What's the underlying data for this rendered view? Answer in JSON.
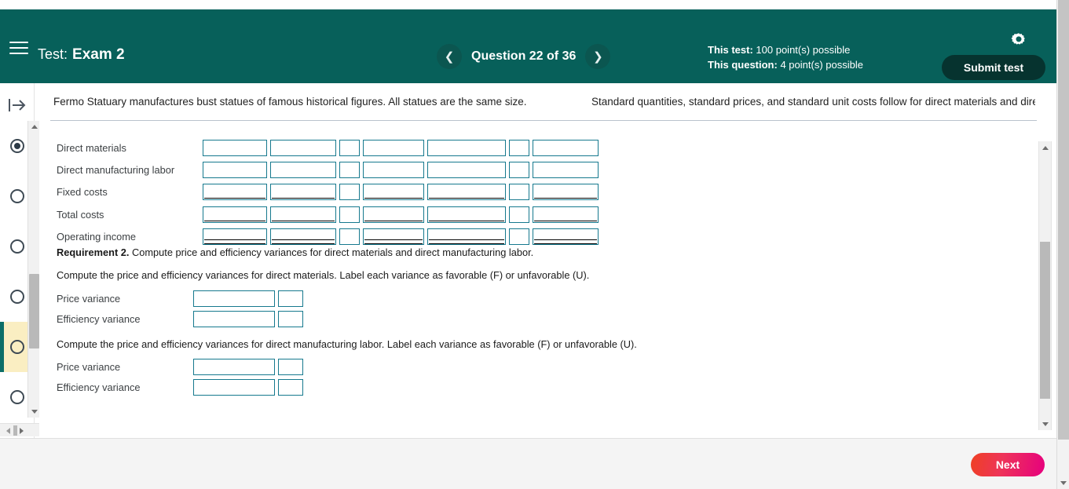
{
  "header": {
    "menu_icon": "hamburger-menu-icon",
    "test_prefix": "Test:",
    "test_name": "Exam 2",
    "prev_icon": "chevron-left-icon",
    "next_icon": "chevron-right-icon",
    "question_counter": "Question 22 of 36",
    "points_test_label": "This test:",
    "points_test_value": "100 point(s) possible",
    "points_question_label": "This question:",
    "points_question_value": "4 point(s) possible",
    "gear_icon": "gear-icon",
    "submit_label": "Submit test",
    "bg_color": "#07605a",
    "submit_bg": "#06332f"
  },
  "rail": {
    "expand_icon": "expand-panel-icon",
    "items": [
      {
        "name": "question-indicator-1",
        "state": "answered"
      },
      {
        "name": "question-indicator-2",
        "state": "empty"
      },
      {
        "name": "question-indicator-3",
        "state": "empty"
      },
      {
        "name": "question-indicator-4",
        "state": "empty"
      },
      {
        "name": "question-indicator-5",
        "state": "current"
      },
      {
        "name": "question-indicator-6",
        "state": "empty"
      }
    ],
    "active_bg": "#faeec2",
    "active_bar": "#0c6e68",
    "scroll_up_icon": "triangle-up-icon",
    "scroll_down_icon": "triangle-down-icon",
    "hscroll_left_icon": "triangle-left-icon",
    "hscroll_right_icon": "triangle-right-icon"
  },
  "prompt": {
    "left_text": "Fermo Statuary manufactures bust statues of famous historical figures. All statues are the same size.",
    "right_text": "Standard quantities, standard prices, and standard unit costs follow for direct materials and direct",
    "left_spinner_icon": "spinner-up-down-icon",
    "right_spinner_icon": "spinner-up-down-icon",
    "vertical_splitter_icon": "vertical-splitter-handle-icon",
    "horizontal_splitter_icon": "horizontal-splitter-dots-icon"
  },
  "content": {
    "table": {
      "rows": [
        {
          "label": "Direct materials",
          "underline": "none"
        },
        {
          "label": "Direct manufacturing labor",
          "underline": "none"
        },
        {
          "label": "Fixed costs",
          "underline": "single"
        },
        {
          "label": "Total costs",
          "underline": "single"
        },
        {
          "label": "Operating income",
          "underline": "double"
        }
      ],
      "columns": [
        {
          "name": "col-1",
          "size": "w1",
          "underlined": true
        },
        {
          "name": "col-2",
          "size": "w2",
          "underlined": true
        },
        {
          "name": "col-3",
          "size": "wn",
          "underlined": false
        },
        {
          "name": "col-4",
          "size": "w3",
          "underlined": true
        },
        {
          "name": "col-5",
          "size": "w4",
          "underlined": true
        },
        {
          "name": "col-6",
          "size": "wn",
          "underlined": false
        },
        {
          "name": "col-7",
          "size": "w2",
          "underlined": true
        }
      ]
    },
    "requirement_label": "Requirement 2.",
    "requirement_text": " Compute price and efficiency variances for direct materials and direct manufacturing labor.",
    "instruction_materials": "Compute the price and efficiency variances for direct materials. Label each variance as favorable (F) or unfavorable (U).",
    "instruction_labor": "Compute the price and efficiency variances for direct manufacturing labor. Label each variance as favorable (F) or unfavorable (U).",
    "materials_variances": [
      {
        "label": "Price variance",
        "value": "",
        "flag": ""
      },
      {
        "label": "Efficiency variance",
        "value": "",
        "flag": ""
      }
    ],
    "labor_variances": [
      {
        "label": "Price variance",
        "value": "",
        "flag": ""
      },
      {
        "label": "Efficiency variance",
        "value": "",
        "flag": ""
      }
    ],
    "input_border_color": "#16798e"
  },
  "footer": {
    "next_label": "Next",
    "next_gradient_start": "#ef4023",
    "next_gradient_end": "#e6007e"
  },
  "window": {
    "scrollbar_down_icon": "triangle-down-icon"
  }
}
